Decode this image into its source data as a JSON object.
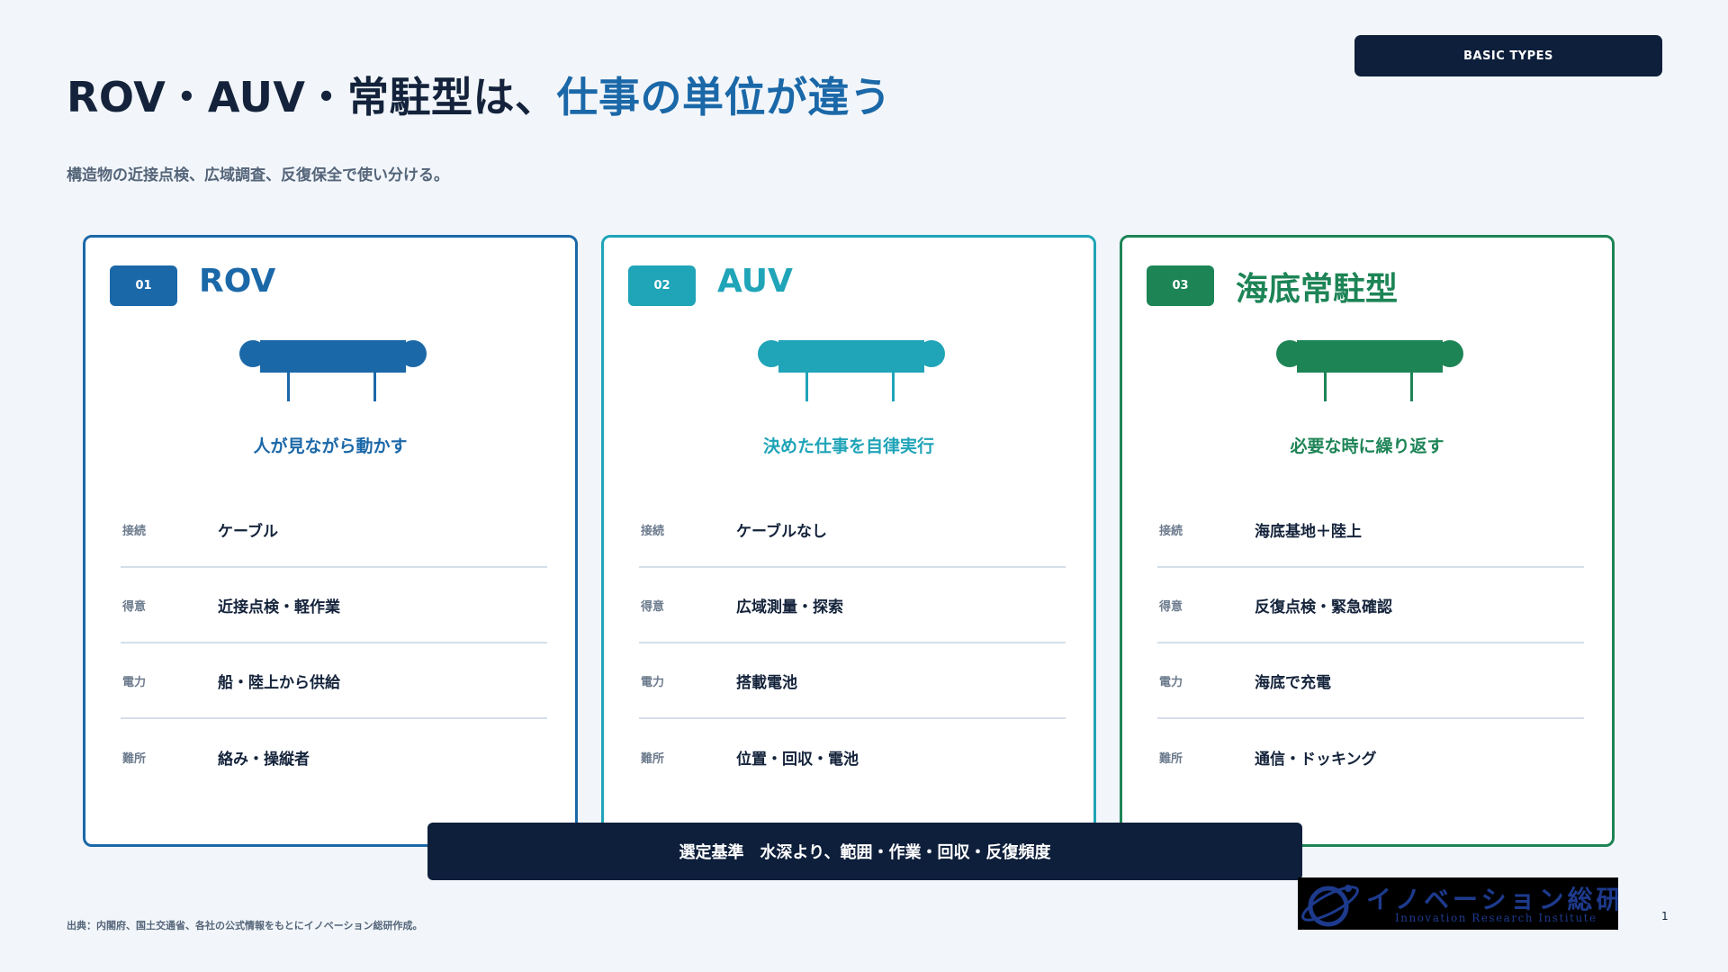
{
  "header": {
    "badge": "BASIC TYPES",
    "title_main": "ROV・AUV・常駐型は、",
    "title_accent": "仕事の単位が違う",
    "subtitle": "構造物の近接点検、広域調査、反復保全で使い分ける。"
  },
  "colors": {
    "rov": "#1b68a8",
    "auv": "#1fa4b8",
    "resident": "#1d8456",
    "navy": "#0e1f3b"
  },
  "cards": [
    {
      "number": "01",
      "title": "ROV",
      "icon": "underwater-vehicle-icon",
      "tagline": "人が見ながら動かす",
      "rows": [
        {
          "label": "接続",
          "value": "ケーブル"
        },
        {
          "label": "得意",
          "value": "近接点検・軽作業"
        },
        {
          "label": "電力",
          "value": "船・陸上から供給"
        },
        {
          "label": "難所",
          "value": "絡み・操縦者"
        }
      ]
    },
    {
      "number": "02",
      "title": "AUV",
      "icon": "underwater-vehicle-icon",
      "tagline": "決めた仕事を自律実行",
      "rows": [
        {
          "label": "接続",
          "value": "ケーブルなし"
        },
        {
          "label": "得意",
          "value": "広域測量・探索"
        },
        {
          "label": "電力",
          "value": "搭載電池"
        },
        {
          "label": "難所",
          "value": "位置・回収・電池"
        }
      ]
    },
    {
      "number": "03",
      "title": "海底常駐型",
      "icon": "underwater-vehicle-icon",
      "tagline": "必要な時に繰り返す",
      "rows": [
        {
          "label": "接続",
          "value": "海底基地＋陸上"
        },
        {
          "label": "得意",
          "value": "反復点検・緊急確認"
        },
        {
          "label": "電力",
          "value": "海底で充電"
        },
        {
          "label": "難所",
          "value": "通信・ドッキング"
        }
      ]
    }
  ],
  "criteria": "選定基準　水深より、範囲・作業・回収・反復頻度",
  "footer": {
    "source": "出典：内閣府、国土交通省、各社の公式情報をもとにイノベーション総研作成。",
    "page_number": "1"
  },
  "logo": {
    "main": "イノベーション総研",
    "sub": "Innovation Research Institute"
  }
}
